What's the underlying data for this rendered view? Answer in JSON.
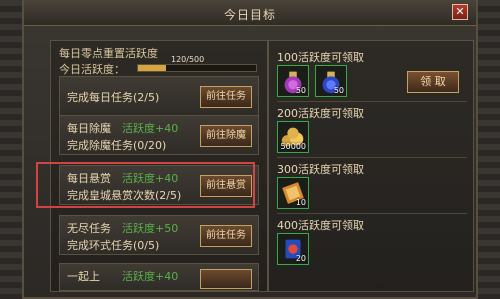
{
  "window": {
    "title": "今日目标",
    "close_icon": "close-icon"
  },
  "activity": {
    "header": "每日零点重置活跃度",
    "progress_label": "今日活跃度：",
    "progress_text": "120/500",
    "progress_value": 0.24
  },
  "tasks": [
    {
      "name": "",
      "points": "",
      "desc": "完成每日任务(2/5)",
      "button": "前往任务"
    },
    {
      "name": "每日除魔",
      "points": "活跃度+40",
      "desc": "完成除魔任务(0/20)",
      "button": "前往除魔"
    },
    {
      "name": "每日悬赏",
      "points": "活跃度+40",
      "desc": "完成皇城悬赏次数(2/5)",
      "button": "前往悬赏"
    },
    {
      "name": "无尽任务",
      "points": "活跃度+50",
      "desc": "完成环式任务(0/5)",
      "button": "前往任务"
    },
    {
      "name": "一起上",
      "points": "活跃度+40",
      "desc": "",
      "button": ""
    }
  ],
  "rewards": [
    {
      "title": "100活跃度可领取",
      "items": [
        {
          "icon": "purple-potion-icon",
          "count": "50"
        },
        {
          "icon": "blue-potion-icon",
          "count": "50"
        }
      ],
      "button": "领 取"
    },
    {
      "title": "200活跃度可领取",
      "items": [
        {
          "icon": "gold-coins-icon",
          "count": "50000"
        }
      ]
    },
    {
      "title": "300活跃度可领取",
      "items": [
        {
          "icon": "scroll-icon",
          "count": "10"
        }
      ]
    },
    {
      "title": "400活跃度可领取",
      "items": [
        {
          "icon": "card-icon",
          "count": "20"
        }
      ]
    }
  ]
}
